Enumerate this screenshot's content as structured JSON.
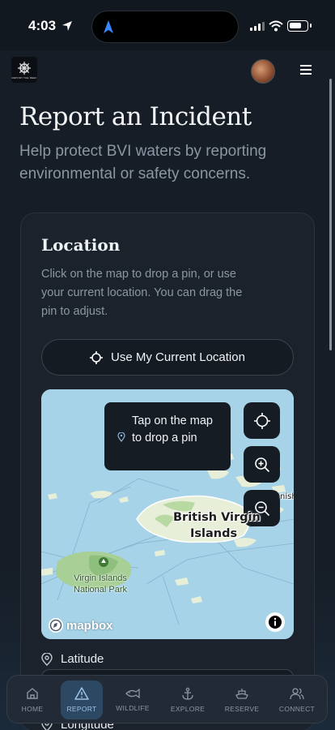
{
  "status_bar": {
    "time": "4:03"
  },
  "header": {
    "logo_text": "REPORT THE REEF",
    "menu_icon": "hamburger-menu-icon"
  },
  "page": {
    "title": "Report an Incident",
    "subtitle": "Help protect BVI waters by reporting environmental or safety concerns."
  },
  "location_card": {
    "title": "Location",
    "description": "Click on the map to drop a pin, or use your current location. You can drag the pin to adjust.",
    "use_location_button": "Use My Current Location",
    "map": {
      "tooltip": "Tap on the map to drop a pin",
      "label_bvi_line1": "British Virgin",
      "label_bvi_line2": "Islands",
      "label_fragment": "nish",
      "label_park_line1": "Virgin Islands",
      "label_park_line2": "National Park",
      "attribution": "mapbox"
    },
    "latitude_label": "Latitude",
    "longitude_label": "Longitude"
  },
  "bottom_nav": {
    "items": [
      {
        "label": "HOME",
        "icon": "home-icon"
      },
      {
        "label": "REPORT",
        "icon": "warning-triangle-icon",
        "active": true
      },
      {
        "label": "WILDLIFE",
        "icon": "fish-icon"
      },
      {
        "label": "EXPLORE",
        "icon": "anchor-icon"
      },
      {
        "label": "RESERVE",
        "icon": "boat-icon"
      },
      {
        "label": "CONNECT",
        "icon": "users-icon"
      }
    ]
  },
  "colors": {
    "background": "#161d26",
    "card": "#1b222c",
    "accent": "#9cc3e8",
    "water": "#a7d3e8",
    "land": "#e8efd8"
  }
}
